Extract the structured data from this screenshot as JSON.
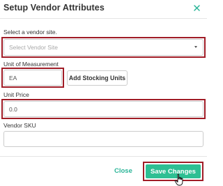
{
  "dialog": {
    "title": "Setup Vendor Attributes",
    "close_icon": "close-x-icon"
  },
  "vendor_site": {
    "label": "Select a vendor site.",
    "placeholder": "Select Vendor Site",
    "icon": "chevron-down-icon"
  },
  "unit_of_measurement": {
    "label": "Unit of Measurement",
    "value": "EA"
  },
  "add_stocking_units_label": "Add Stocking Units",
  "unit_price": {
    "label": "Unit Price",
    "value": "0.0"
  },
  "vendor_sku": {
    "label": "Vendor SKU",
    "value": ""
  },
  "footer": {
    "close_label": "Close",
    "save_label": "Save Changes"
  },
  "colors": {
    "accent_green": "#2ebf93",
    "link_green": "#2bb598",
    "highlight_red": "#a01c26"
  },
  "cursor_icon": "hand-pointer-icon"
}
